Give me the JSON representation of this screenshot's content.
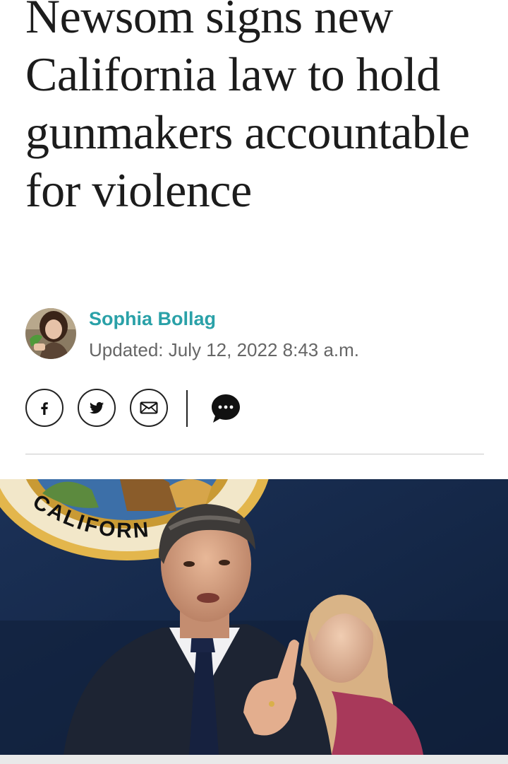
{
  "article": {
    "headline": "Newsom signs new California law to hold gunmakers accountable for violence",
    "author": "Sophia Bollag",
    "updated": "Updated: July 12, 2022 8:43 a.m."
  },
  "share": {
    "buttons": [
      {
        "name": "facebook",
        "icon": "facebook-icon"
      },
      {
        "name": "twitter",
        "icon": "twitter-icon"
      },
      {
        "name": "email",
        "icon": "mail-icon"
      }
    ],
    "comment_icon": "comment-bubble-icon"
  },
  "hero": {
    "seal_text": "CALIFORN"
  },
  "colors": {
    "author_link": "#2aa1a8",
    "text": "#1c1c1c",
    "meta": "#666666",
    "photo_backdrop": "#152848",
    "seal_gold": "#d9a93c"
  }
}
